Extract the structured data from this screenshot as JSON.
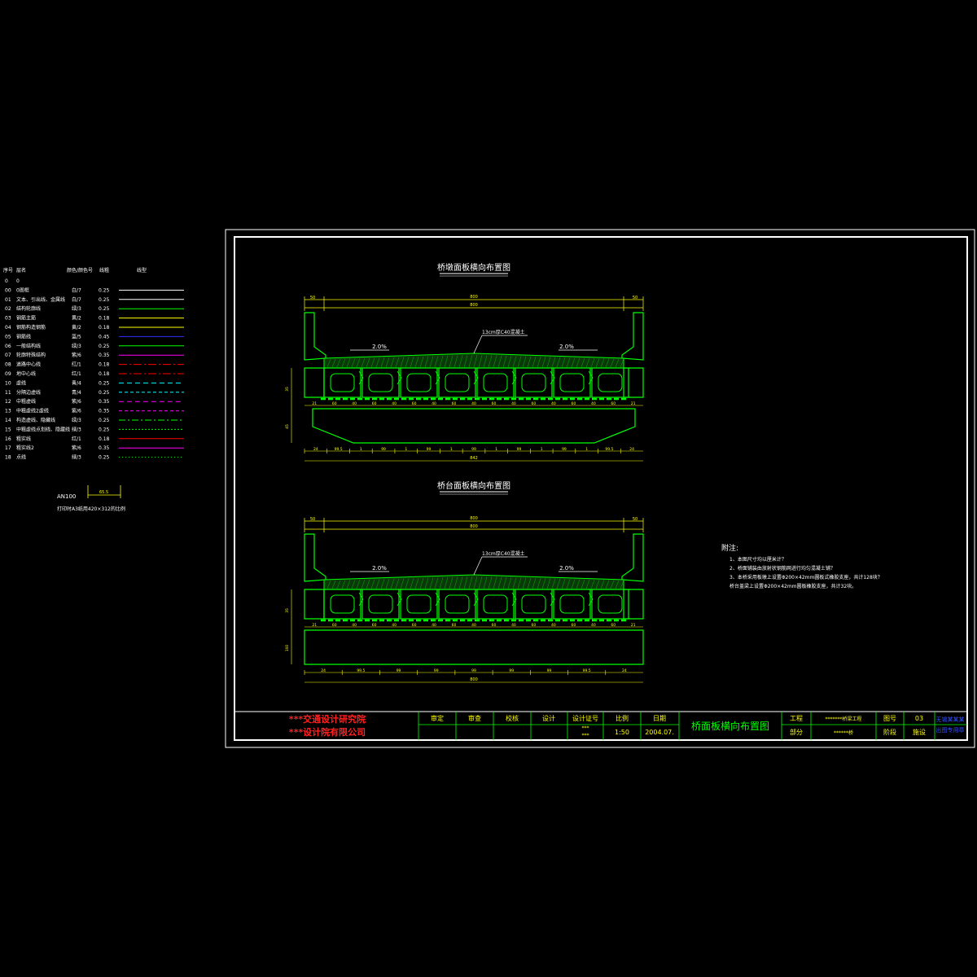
{
  "legend": {
    "headers": {
      "no": "序号",
      "name": "层名",
      "color": "颜色/颜色号",
      "width": "线粗",
      "type": "线型"
    },
    "rows": [
      {
        "no": "0",
        "name": "0",
        "color": "",
        "width": "",
        "line": "#000000",
        "dash": "none"
      },
      {
        "no": "00",
        "name": "0图框",
        "color": "白/7",
        "width": "0.25",
        "line": "#ffffff",
        "dash": "none"
      },
      {
        "no": "01",
        "name": "文本、引出线、金属线",
        "color": "白/7",
        "width": "0.25",
        "line": "#ffffff",
        "dash": "none"
      },
      {
        "no": "02",
        "name": "结构轮廓线",
        "color": "绿/3",
        "width": "0.25",
        "line": "#00ff00",
        "dash": "none"
      },
      {
        "no": "03",
        "name": "钢筋主筋",
        "color": "黄/2",
        "width": "0.18",
        "line": "#ffff00",
        "dash": "none"
      },
      {
        "no": "04",
        "name": "钢筋构造钢筋",
        "color": "黄/2",
        "width": "0.18",
        "line": "#ffff00",
        "dash": "none"
      },
      {
        "no": "05",
        "name": "钢筋线",
        "color": "蓝/5",
        "width": "0.45",
        "line": "#3030ff",
        "dash": "none"
      },
      {
        "no": "06",
        "name": "一般结构线",
        "color": "绿/3",
        "width": "0.25",
        "line": "#00ff00",
        "dash": "none"
      },
      {
        "no": "07",
        "name": "轮廓特殊结构",
        "color": "紫/6",
        "width": "0.35",
        "line": "#ff00ff",
        "dash": "none"
      },
      {
        "no": "08",
        "name": "道路中心线",
        "color": "红/1",
        "width": "0.18",
        "line": "#ff0000",
        "dash": "10 3 2 3"
      },
      {
        "no": "09",
        "name": "地中心线",
        "color": "红/1",
        "width": "0.18",
        "line": "#ff0000",
        "dash": "10 3 2 3"
      },
      {
        "no": "10",
        "name": "虚线",
        "color": "青/4",
        "width": "0.25",
        "line": "#00ffff",
        "dash": "6 4"
      },
      {
        "no": "11",
        "name": "分隔边虚线",
        "color": "青/4",
        "width": "0.25",
        "line": "#00ffff",
        "dash": "4 3"
      },
      {
        "no": "12",
        "name": "中粗虚线",
        "color": "紫/6",
        "width": "0.35",
        "line": "#ff00ff",
        "dash": "6 4"
      },
      {
        "no": "13",
        "name": "中粗虚线2虚线",
        "color": "紫/6",
        "width": "0.35",
        "line": "#ff00ff",
        "dash": "4 3"
      },
      {
        "no": "14",
        "name": "构造虚线、隐藏线",
        "color": "绿/3",
        "width": "0.25",
        "line": "#00ff00",
        "dash": "8 3 2 3"
      },
      {
        "no": "15",
        "name": "中粗虚线点划线、隐藏线",
        "color": "绿/3",
        "width": "0.25",
        "line": "#00ff00",
        "dash": "2 2"
      },
      {
        "no": "16",
        "name": "粗实线",
        "color": "红/1",
        "width": "0.18",
        "line": "#ff0000",
        "dash": "none"
      },
      {
        "no": "17",
        "name": "粗实线2",
        "color": "紫/6",
        "width": "0.35",
        "line": "#ff00ff",
        "dash": "none"
      },
      {
        "no": "18",
        "name": "点线",
        "color": "绿/3",
        "width": "0.25",
        "line": "#00ff00",
        "dash": "1 3"
      }
    ],
    "scale_tag": "AN100",
    "scale_dim": "65.5",
    "note": "打印时A3纸用420×312的比例"
  },
  "drawing1": {
    "title": "桥墩面板横向布置图",
    "slab": "13cm厚C40混凝土",
    "slope": "2.0%",
    "dims_top": {
      "left": "50",
      "total_outer": "800",
      "total_inner": "800",
      "right": "50"
    },
    "web_dims": [
      "21",
      "60",
      "40",
      "60",
      "40",
      "60",
      "40",
      "60",
      "40",
      "60",
      "40",
      "60",
      "40",
      "60",
      "40",
      "60",
      "21"
    ],
    "dims_bottom": [
      "24",
      "99.5",
      "1",
      "99",
      "1",
      "99",
      "1",
      "99",
      "1",
      "99",
      "1",
      "99",
      "1",
      "99.5",
      "24"
    ],
    "dims_bottom_total": "842",
    "height_dims": [
      "35",
      "45"
    ]
  },
  "drawing2": {
    "title": "桥台面板横向布置图",
    "slab": "13cm厚C40混凝土",
    "slope": "2.0%",
    "dims_top": {
      "left": "50",
      "total_outer": "800",
      "total_inner": "800",
      "right": "50"
    },
    "web_dims": [
      "21",
      "60",
      "40",
      "60",
      "40",
      "60",
      "40",
      "60",
      "40",
      "60",
      "40",
      "60",
      "40",
      "60",
      "40",
      "60",
      "21"
    ],
    "dims_bottom": [
      "24",
      "99.5",
      "99",
      "99",
      "99",
      "99",
      "99",
      "99.5",
      "24"
    ],
    "dims_bottom_total": "800",
    "height_dims": [
      "35",
      "100"
    ]
  },
  "notes": {
    "heading": "附注:",
    "lines": [
      "1、本图尺寸均以厘米计？",
      "2、桥面铺装由放射状钢筋网进行均匀混凝土铺？",
      "3、本桥采用板墩上设置Φ200×42mm圆板式橡胶支座，共计128块？",
      "   桥台盖梁上设置Φ200×42mm圆板橡胶支座，共计32块。"
    ]
  },
  "title_block": {
    "org1": "***交通设计研究院",
    "org2": "***设计院有限公司",
    "headers": [
      "审定",
      "审查",
      "校核",
      "设计"
    ],
    "cert_label": "设计证号",
    "cert_values": [
      "***",
      "***"
    ],
    "scale_label": "比例",
    "scale_value": "1:50",
    "date_label": "日期",
    "date_value": "2004.07.",
    "drawing_title": "桥面板横向布置图",
    "project_label": "工程",
    "project_value": "*******桥梁工程",
    "part_label": "部分",
    "part_value": "******桥",
    "drawing_no_label": "图号",
    "drawing_no_value": "03",
    "stage_label": "阶段",
    "stage_value": "施设",
    "stamp1": "无锡某某某",
    "stamp2": "出图专用章"
  },
  "colors": {
    "frame": "#ffffff",
    "structure": "#00ff00",
    "text": "#ffff00",
    "org": "#ff2020",
    "stamp": "#3050ff"
  }
}
